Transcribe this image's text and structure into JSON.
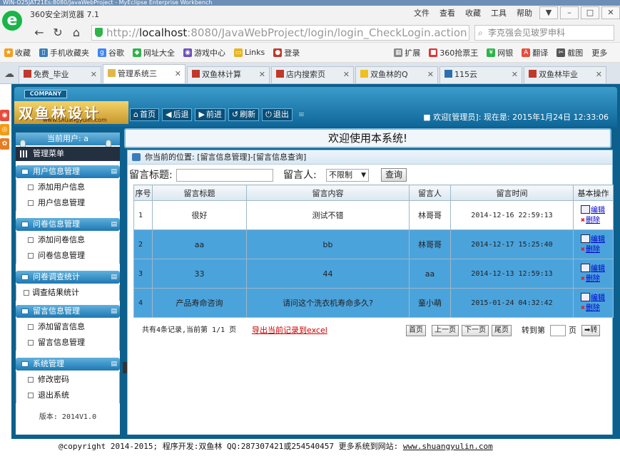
{
  "window": {
    "os_title": "WIN-O25JAT21Es:8080/JavaWebProject - MyEclipse Enterprise Workbench",
    "browser_name": "360安全浏览器 7.1",
    "menu": [
      "文件",
      "查看",
      "收藏",
      "工具",
      "帮助"
    ]
  },
  "address": {
    "scheme": "http://",
    "host": "localhost",
    "path": ":8080/JavaWebProject/login/login_CheckLogin.action",
    "search_placeholder": "李克强会见玻罗申科"
  },
  "favorites": [
    "收藏",
    "手机收藏夹",
    "谷歌",
    "网址大全",
    "游戏中心",
    "Links",
    "登录",
    "扩展",
    "360抢票王",
    "网银",
    "翻译",
    "截图",
    "更多"
  ],
  "tabs": [
    {
      "label": "免费_毕业",
      "active": false
    },
    {
      "label": "管理系统三",
      "active": true
    },
    {
      "label": "双鱼林计算",
      "active": false
    },
    {
      "label": "店内搜索页",
      "active": false
    },
    {
      "label": "双鱼林的Q",
      "active": false
    },
    {
      "label": "115云",
      "active": false
    },
    {
      "label": "双鱼林毕业",
      "active": false
    }
  ],
  "header": {
    "company": "COMPANY",
    "brand_title": "双鱼林设计",
    "brand_url": "www.shuangyulin.com",
    "toolbar": [
      "首页",
      "后退",
      "前进",
      "刷新",
      "退出"
    ],
    "welcome": "■ 欢迎[管理员]: 现在是: 2015年1月24日 12:33:06"
  },
  "banner": "欢迎使用本系统!",
  "sidebar": {
    "user_label": "当前用户: a",
    "mgmt_label": "管理菜单",
    "sections": [
      {
        "title": "用户信息管理",
        "items": [
          "添加用户信息",
          "用户信息管理"
        ]
      },
      {
        "title": "问卷信息管理",
        "items": [
          "添加问卷信息",
          "问卷信息管理"
        ]
      },
      {
        "title": "问卷调查统计",
        "items": [
          "调查结果统计"
        ]
      },
      {
        "title": "留言信息管理",
        "items": [
          "添加留言信息",
          "留言信息管理"
        ]
      },
      {
        "title": "系统管理",
        "items": [
          "修改密码",
          "退出系统"
        ]
      }
    ],
    "version": "版本: 2014V1.0"
  },
  "main": {
    "location": "你当前的位置: [留言信息管理]-[留言信息查询]",
    "filter": {
      "title_label": "留言标题:",
      "person_label": "留言人:",
      "person_value": "不限制",
      "query_button": "查询"
    },
    "table": {
      "headers": [
        "序号",
        "留言标题",
        "留言内容",
        "留言人",
        "留言时间",
        "基本操作"
      ],
      "rows": [
        {
          "no": "1",
          "title": "很好",
          "content": "测试不错",
          "person": "林哥哥",
          "time": "2014-12-16 22:59:13",
          "selected": false
        },
        {
          "no": "2",
          "title": "aa",
          "content": "bb",
          "person": "林哥哥",
          "time": "2014-12-17 15:25:40",
          "selected": true
        },
        {
          "no": "3",
          "title": "33",
          "content": "44",
          "person": "aa",
          "time": "2014-12-13 12:59:13",
          "selected": true
        },
        {
          "no": "4",
          "title": "产品寿命咨询",
          "content": "请问这个洗衣机寿命多久?",
          "person": "童小萌",
          "time": "2015-01-24 04:32:42",
          "selected": true
        }
      ],
      "edit_label": "编辑",
      "delete_label": "删除"
    },
    "pager": {
      "info": "共有4条记录,当前第 1/1 页",
      "export": "导出当前记录到excel",
      "first": "首页",
      "prev": "上一页",
      "next": "下一页",
      "last": "尾页",
      "goto_label": "转到第",
      "page_unit": "页",
      "go": "➡转"
    }
  },
  "footer": {
    "text": "@copyright 2014-2015; 程序开发:双鱼林  QQ:287307421或254540457  更多系统到网站:",
    "link": "www.shuangyulin.com"
  },
  "colors": {
    "frame": "#0d5f8c",
    "selected_row": "#4ba3dc",
    "brand_gold": "#e3b64b"
  }
}
